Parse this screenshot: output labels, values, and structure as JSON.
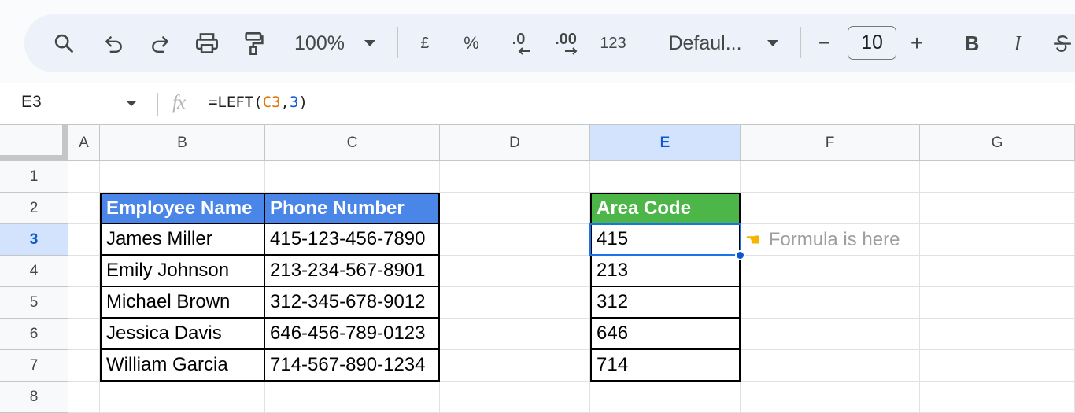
{
  "toolbar": {
    "zoom": "100%",
    "currency": "£",
    "percent": "%",
    "decrease_decimal": ".0",
    "increase_decimal": ".00",
    "number_format": "123",
    "font": "Defaul...",
    "font_size": "10",
    "minus": "−",
    "plus": "+",
    "bold": "B",
    "italic": "I"
  },
  "formula_bar": {
    "cell_ref": "E3",
    "fx": "fx",
    "formula_prefix": "=LEFT(",
    "formula_ref": "C3",
    "formula_comma": ",",
    "formula_num": "3",
    "formula_suffix": ")"
  },
  "columns": [
    "A",
    "B",
    "C",
    "D",
    "E",
    "F",
    "G"
  ],
  "rows": [
    "1",
    "2",
    "3",
    "4",
    "5",
    "6",
    "7",
    "8"
  ],
  "table": {
    "headers": [
      "Employee Name",
      "Phone Number"
    ],
    "rows": [
      [
        "James Miller",
        "415-123-456-7890"
      ],
      [
        "Emily Johnson",
        "213-234-567-8901"
      ],
      [
        "Michael Brown",
        "312-345-678-9012"
      ],
      [
        "Jessica Davis",
        "646-456-789-0123"
      ],
      [
        "William Garcia",
        "714-567-890-1234"
      ]
    ]
  },
  "area_code": {
    "header": "Area Code",
    "values": [
      "415",
      "213",
      "312",
      "646",
      "714"
    ]
  },
  "note": {
    "icon": "pointing-hand-icon",
    "text": "Formula is here"
  },
  "colors": {
    "header_blue": "#4a86e8",
    "header_green": "#4cb748",
    "selection": "#1a73e8"
  }
}
